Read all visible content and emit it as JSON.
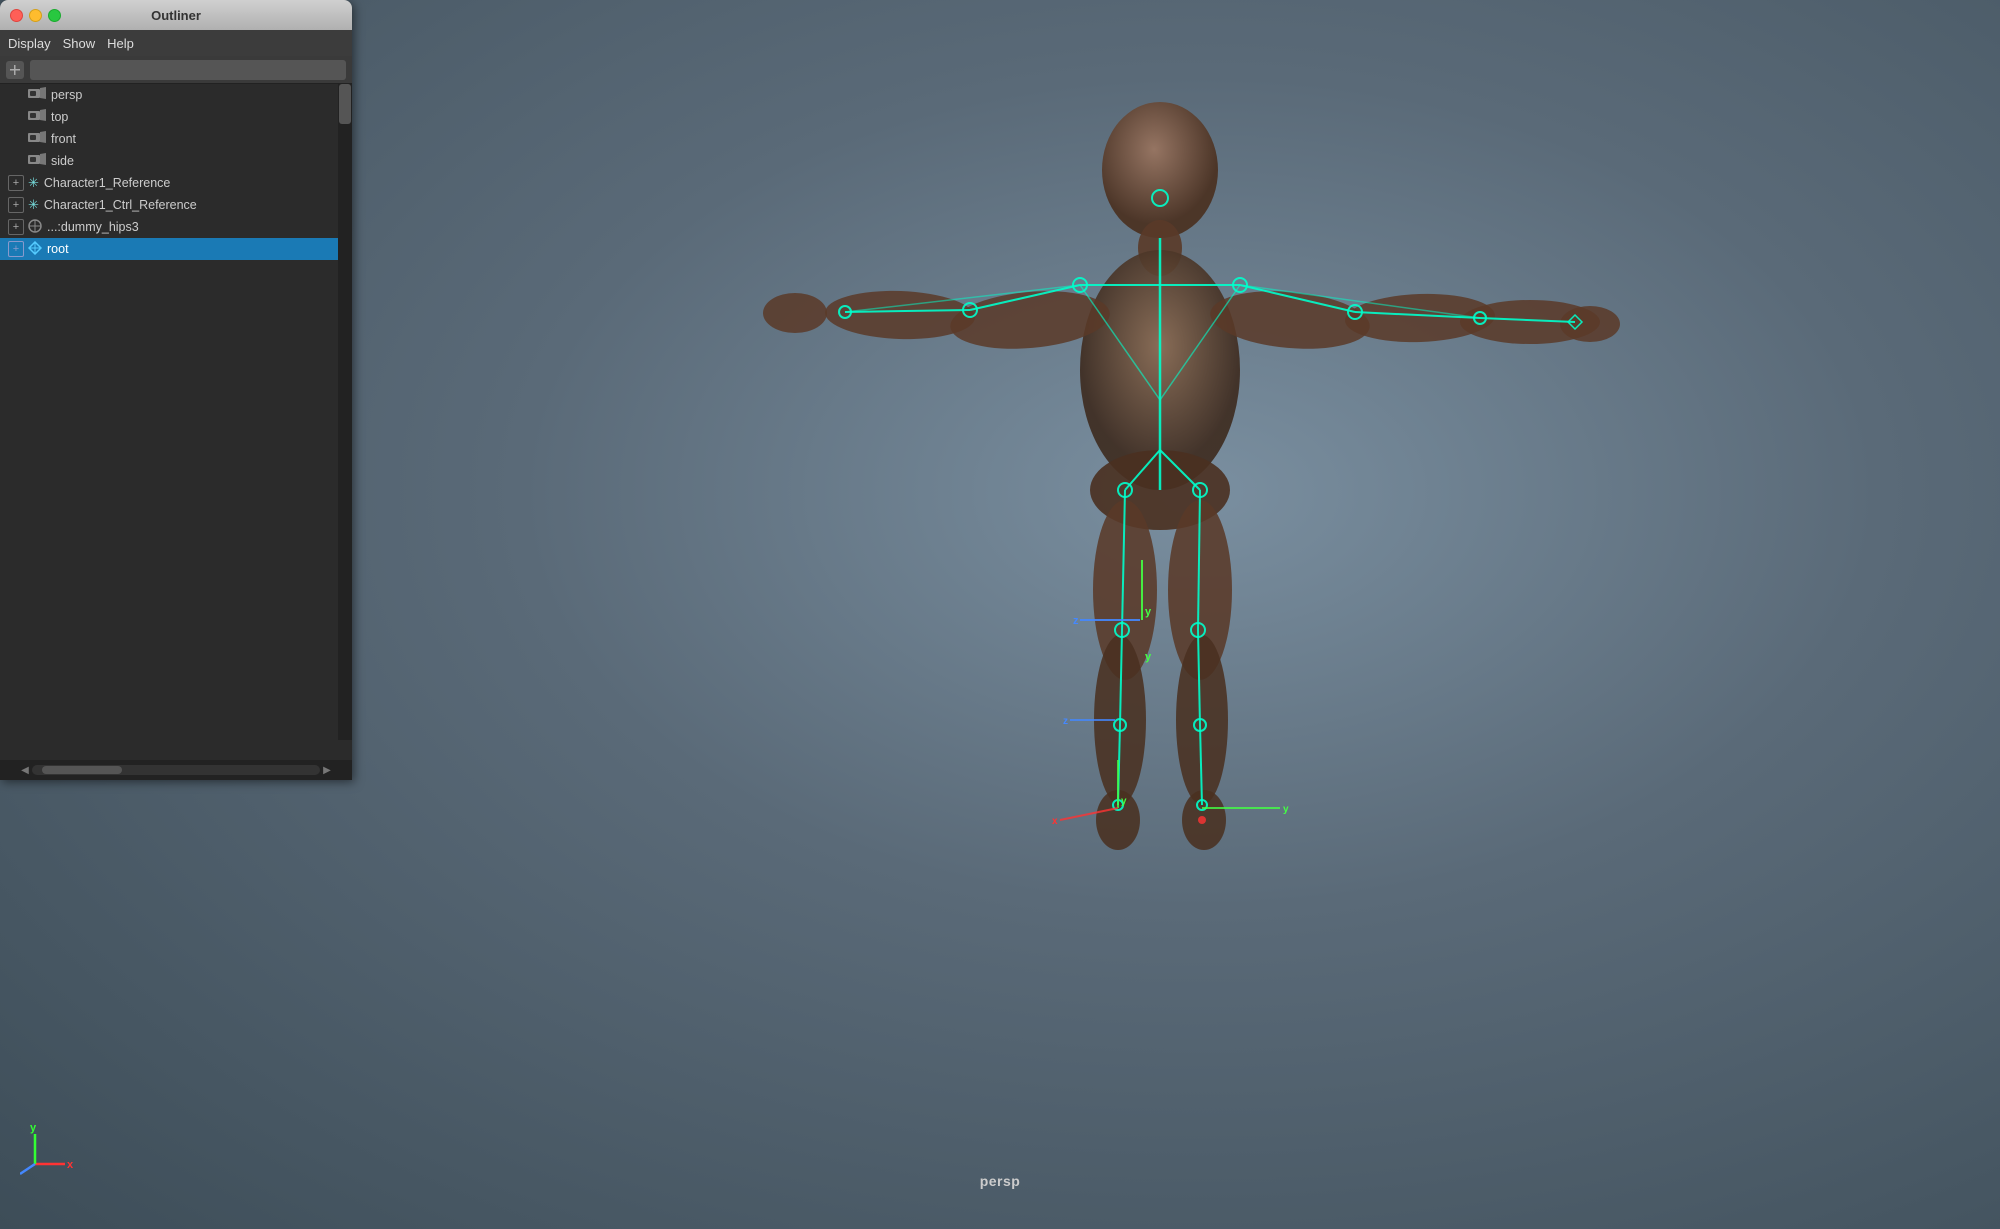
{
  "window": {
    "title": "Outliner",
    "traffic_lights": [
      "close",
      "minimize",
      "maximize"
    ]
  },
  "menu": {
    "items": [
      "Display",
      "Show",
      "Help"
    ]
  },
  "search": {
    "placeholder": ""
  },
  "outliner": {
    "items": [
      {
        "id": "persp",
        "label": "persp",
        "icon": "camera",
        "expanded": false,
        "indent": 1,
        "selected": false
      },
      {
        "id": "top",
        "label": "top",
        "icon": "camera",
        "expanded": false,
        "indent": 1,
        "selected": false
      },
      {
        "id": "front",
        "label": "front",
        "icon": "camera",
        "expanded": false,
        "indent": 1,
        "selected": false
      },
      {
        "id": "side",
        "label": "side",
        "icon": "camera",
        "expanded": false,
        "indent": 1,
        "selected": false
      },
      {
        "id": "char1_ref",
        "label": "Character1_Reference",
        "icon": "reference",
        "expanded": false,
        "indent": 0,
        "selected": false
      },
      {
        "id": "char1_ctrl_ref",
        "label": "Character1_Ctrl_Reference",
        "icon": "reference",
        "expanded": false,
        "indent": 0,
        "selected": false
      },
      {
        "id": "dummy_hips3",
        "label": "...:dummy_hips3",
        "icon": "dummy",
        "expanded": false,
        "indent": 0,
        "selected": false
      },
      {
        "id": "root",
        "label": "root",
        "icon": "root",
        "expanded": false,
        "indent": 0,
        "selected": true
      }
    ]
  },
  "viewport": {
    "label": "persp",
    "axis_labels": {
      "x": "x",
      "y": "y",
      "z": "z"
    }
  },
  "colors": {
    "skeleton": "#00ffcc",
    "selected_bg": "#1a7ab5",
    "axis_x": "#ff3333",
    "axis_y": "#33ff33",
    "axis_z": "#3333ff"
  }
}
